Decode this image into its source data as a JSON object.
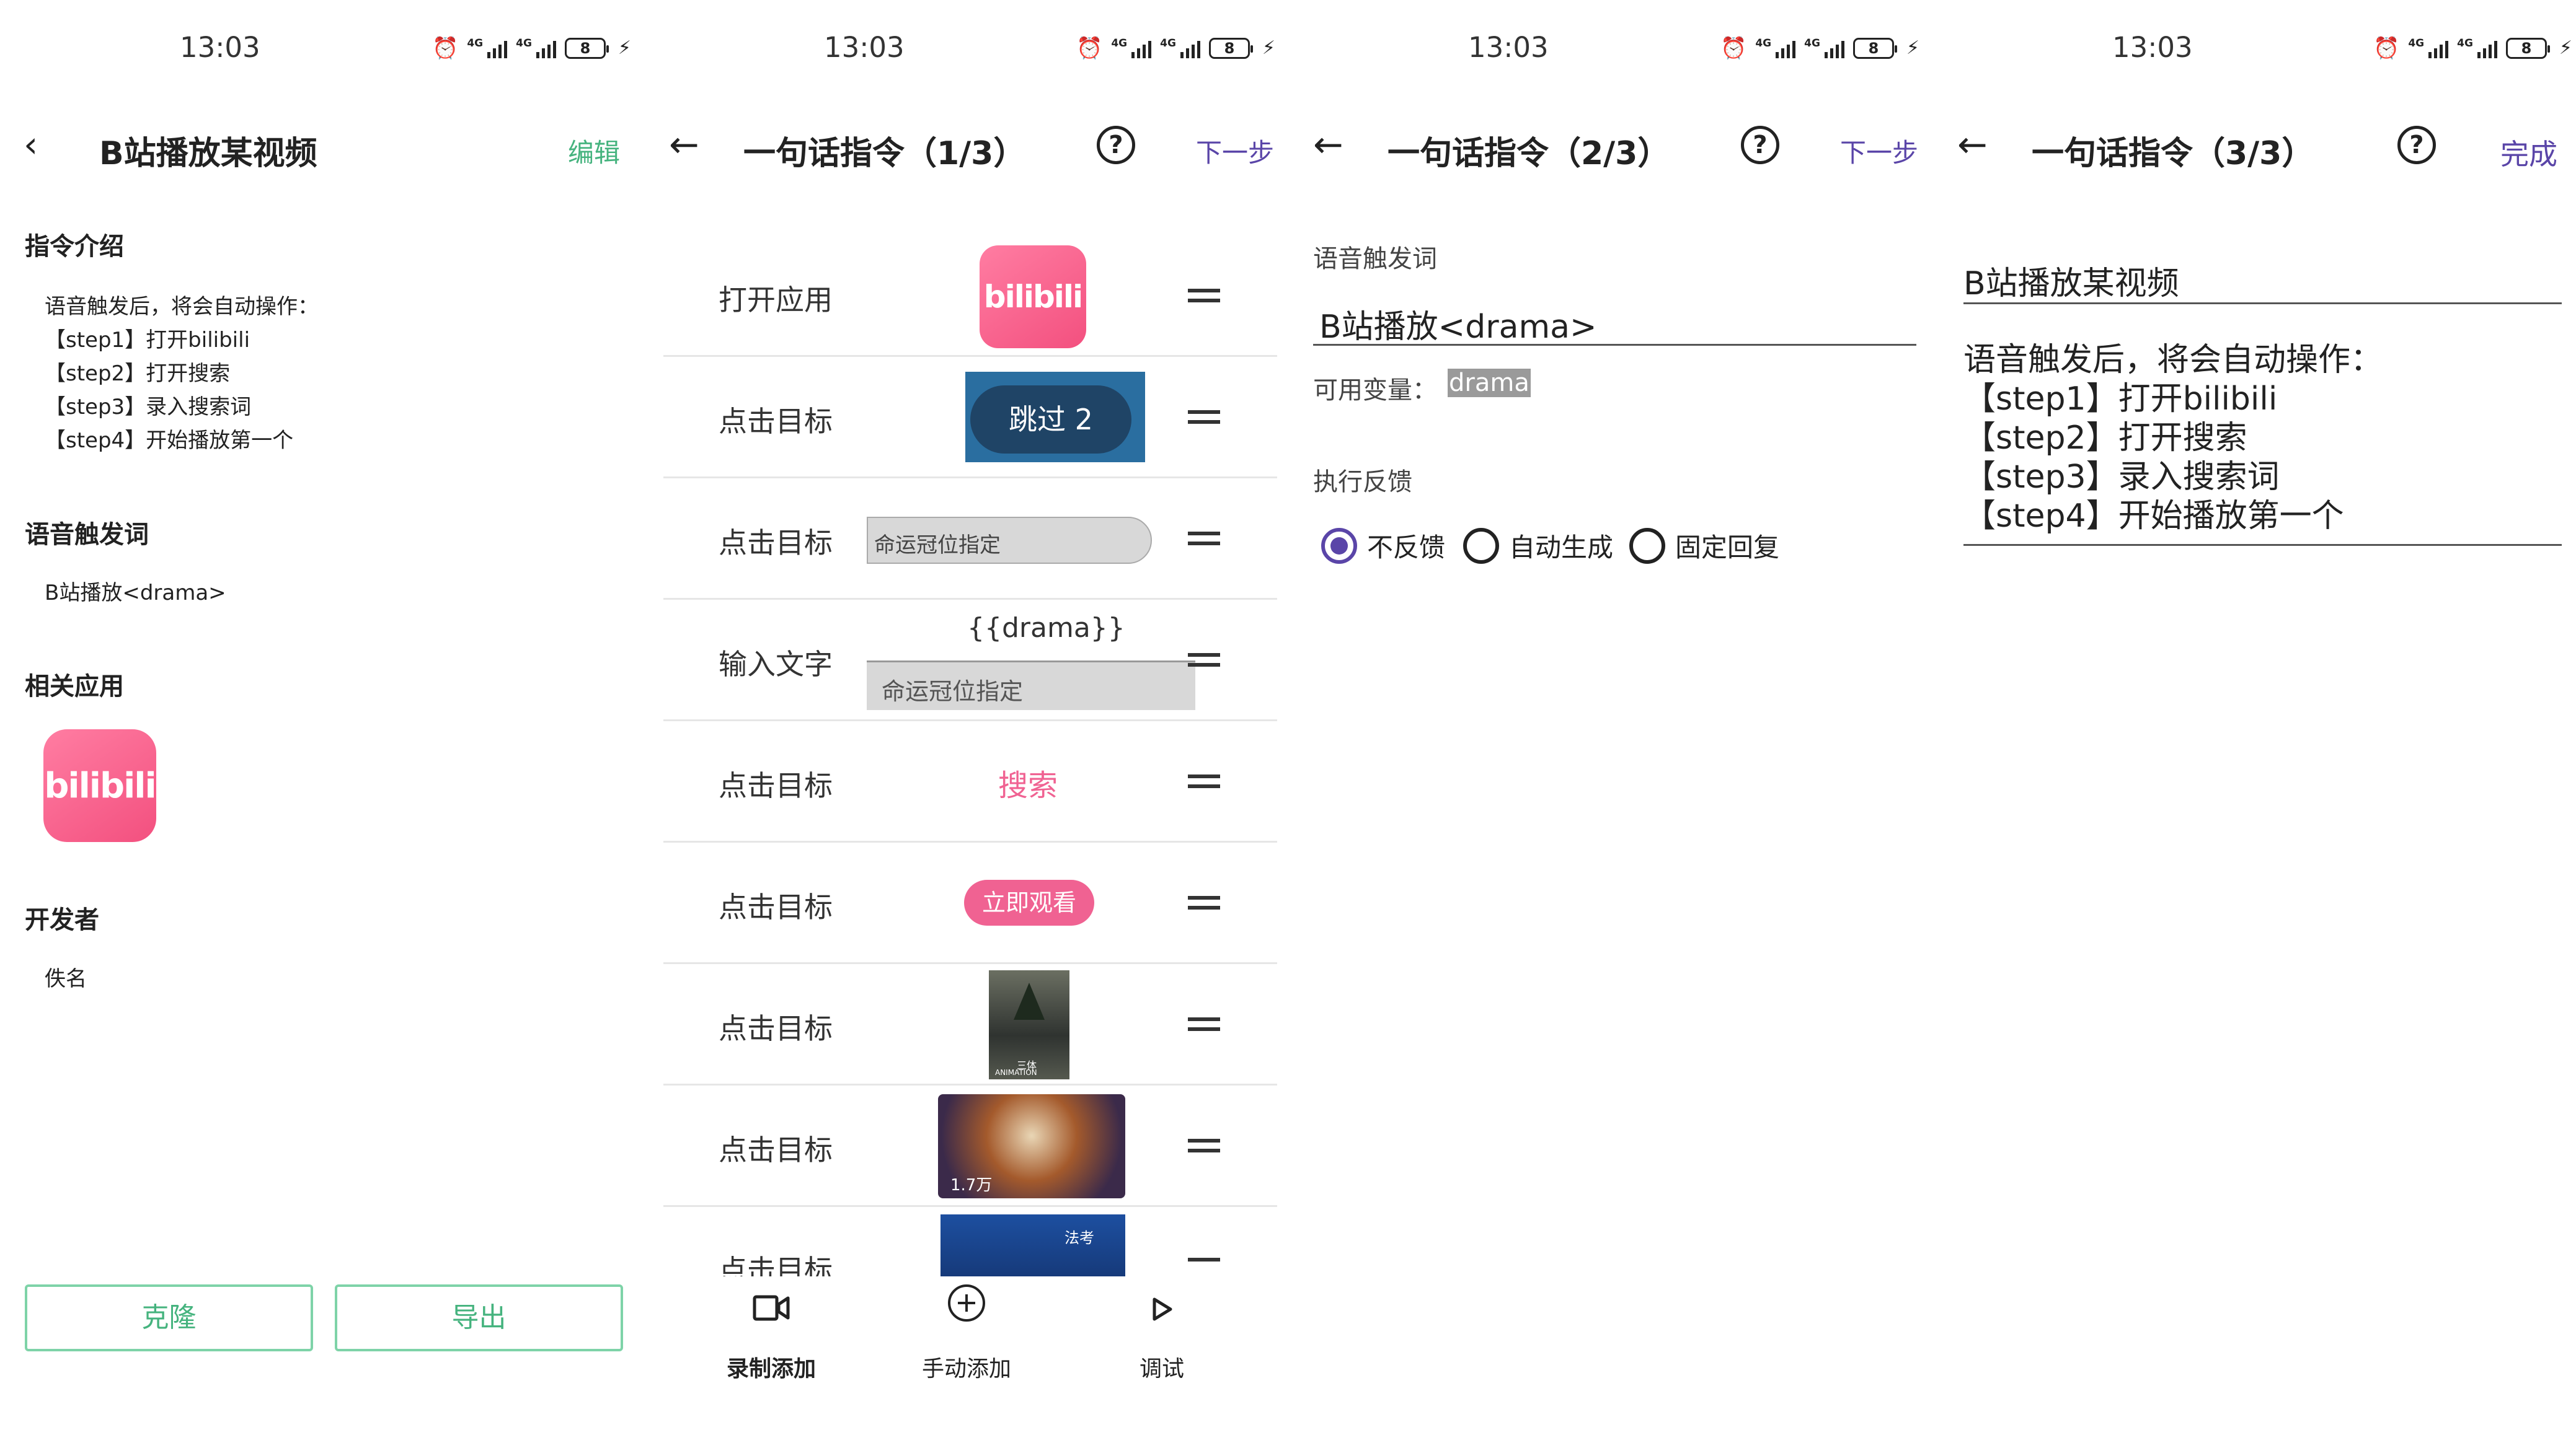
{
  "status": {
    "time": "13:03",
    "net1": "4G",
    "net2": "4G",
    "battery": "8"
  },
  "panel1": {
    "title": "B站播放某视频",
    "edit": "编辑",
    "intro_heading": "指令介绍",
    "intro_lines": [
      "语音触发后，将会自动操作：",
      "【step1】打开bilibili",
      "【step2】打开搜索",
      "【step3】录入搜索词",
      "【step4】开始播放第一个"
    ],
    "voice_heading": "语音触发词",
    "voice_value": "B站播放<drama>",
    "app_heading": "相关应用",
    "app_logo": "bilibili",
    "dev_heading": "开发者",
    "dev_value": "佚名",
    "clone_btn": "克隆",
    "export_btn": "导出"
  },
  "panel2": {
    "title": "一句话指令（1/3）",
    "next": "下一步",
    "rows": [
      {
        "label": "打开应用",
        "target": "bilibili"
      },
      {
        "label": "点击目标",
        "target": "跳过 2"
      },
      {
        "label": "点击目标",
        "target": "命运冠位指定"
      },
      {
        "label": "输入文字",
        "target": "{{drama}}",
        "target2": "命运冠位指定"
      },
      {
        "label": "点击目标",
        "target": "搜索"
      },
      {
        "label": "点击目标",
        "target": "立即观看"
      },
      {
        "label": "点击目标",
        "target": "三体",
        "target2": "ANIMATION"
      },
      {
        "label": "点击目标",
        "target": "1.7万"
      },
      {
        "label": "点击目标",
        "target": "法考"
      }
    ],
    "nav": [
      {
        "label": "录制添加",
        "icon": "video-camera-icon"
      },
      {
        "label": "手动添加",
        "icon": "plus-circle-icon"
      },
      {
        "label": "调试",
        "icon": "play-icon"
      }
    ]
  },
  "panel3": {
    "title": "一句话指令（2/3）",
    "next": "下一步",
    "voice_label": "语音触发词",
    "voice_value": "B站播放<drama>",
    "vars_label": "可用变量：",
    "vars_value": "drama",
    "feedback_label": "执行反馈",
    "options": [
      "不反馈",
      "自动生成",
      "固定回复"
    ],
    "selected": "不反馈"
  },
  "panel4": {
    "title": "一句话指令（3/3）",
    "done": "完成",
    "name_value": "B站播放某视频",
    "desc_lines": [
      "语音触发后，将会自动操作：",
      "【step1】打开bilibili",
      "【step2】打开搜索",
      "【step3】录入搜索词",
      "【step4】开始播放第一个"
    ]
  },
  "colors": {
    "accent_green": "#45b37e",
    "accent_purple": "#5a45a8",
    "bili_pink": "#f06292"
  }
}
